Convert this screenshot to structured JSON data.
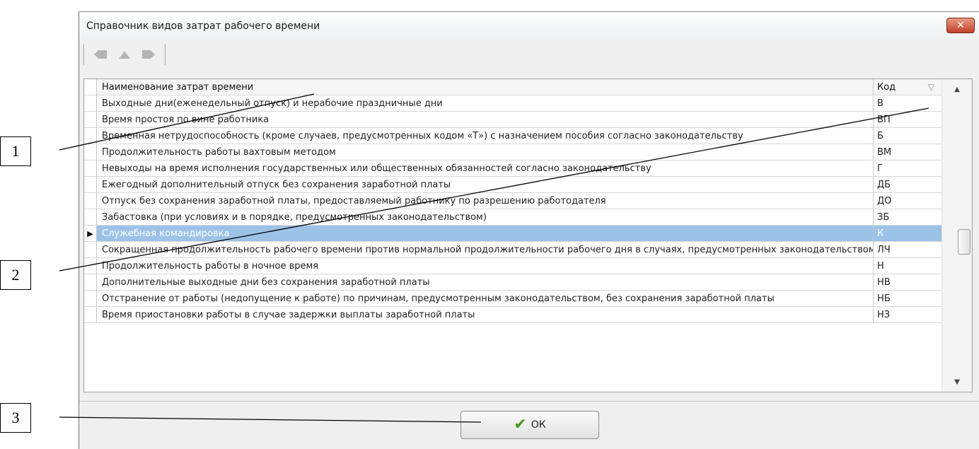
{
  "window": {
    "title": "Справочник видов затрат рабочего времени",
    "close_label": "✕"
  },
  "callouts": [
    "1",
    "2",
    "3"
  ],
  "grid": {
    "columns": {
      "name": "Наименование затрат времени",
      "code": "Код"
    },
    "rows": [
      {
        "name": "Выходные дни(еженедельный отпуск) и нерабочие праздничные дни",
        "code": "В"
      },
      {
        "name": "Время простоя по вине работника",
        "code": "ВП"
      },
      {
        "name": "Временная нетрудоспособность (кроме случаев, предусмотренных кодом «Т») с назначением пособия согласно законодательству",
        "code": "Б"
      },
      {
        "name": "Продолжительность работы вахтовым методом",
        "code": "ВМ"
      },
      {
        "name": "Невыходы на время исполнения государственных или общественных обязанностей согласно законодательству",
        "code": "Г"
      },
      {
        "name": "Ежегодный дополнительный отпуск без сохранения заработной платы",
        "code": "ДБ"
      },
      {
        "name": "Отпуск без сохранения заработной платы, предоставляемый работнику по разрешению работодателя",
        "code": "ДО"
      },
      {
        "name": "Забастовка (при условиях и в порядке, предусмотренных законодательством)",
        "code": "ЗБ"
      },
      {
        "name": "Служебная командировка",
        "code": "К"
      },
      {
        "name": "Сокращенная продолжительность рабочего времени против нормальной продолжительности рабочего дня в случаях, предусмотренных законодательством",
        "code": "ЛЧ"
      },
      {
        "name": "Продолжительность работы в ночное время",
        "code": "Н"
      },
      {
        "name": "Дополнительные выходные дни без сохранения заработной платы",
        "code": "НВ"
      },
      {
        "name": "Отстранение от работы (недопущение к работе) по причинам, предусмотренным законодательством, без сохранения заработной платы",
        "code": "НБ"
      },
      {
        "name": "Время приостановки работы в случае задержки выплаты заработной платы",
        "code": "НЗ"
      }
    ],
    "selected_index": 8
  },
  "buttons": {
    "ok_label": "ОК"
  },
  "colors": {
    "selection": "#9cc2e8",
    "accent_check": "#4a9a18",
    "close": "#c4412a"
  },
  "icons": [
    "back-icon",
    "up-icon",
    "forward-icon",
    "sort-desc-icon",
    "check-icon",
    "row-pointer-icon"
  ]
}
